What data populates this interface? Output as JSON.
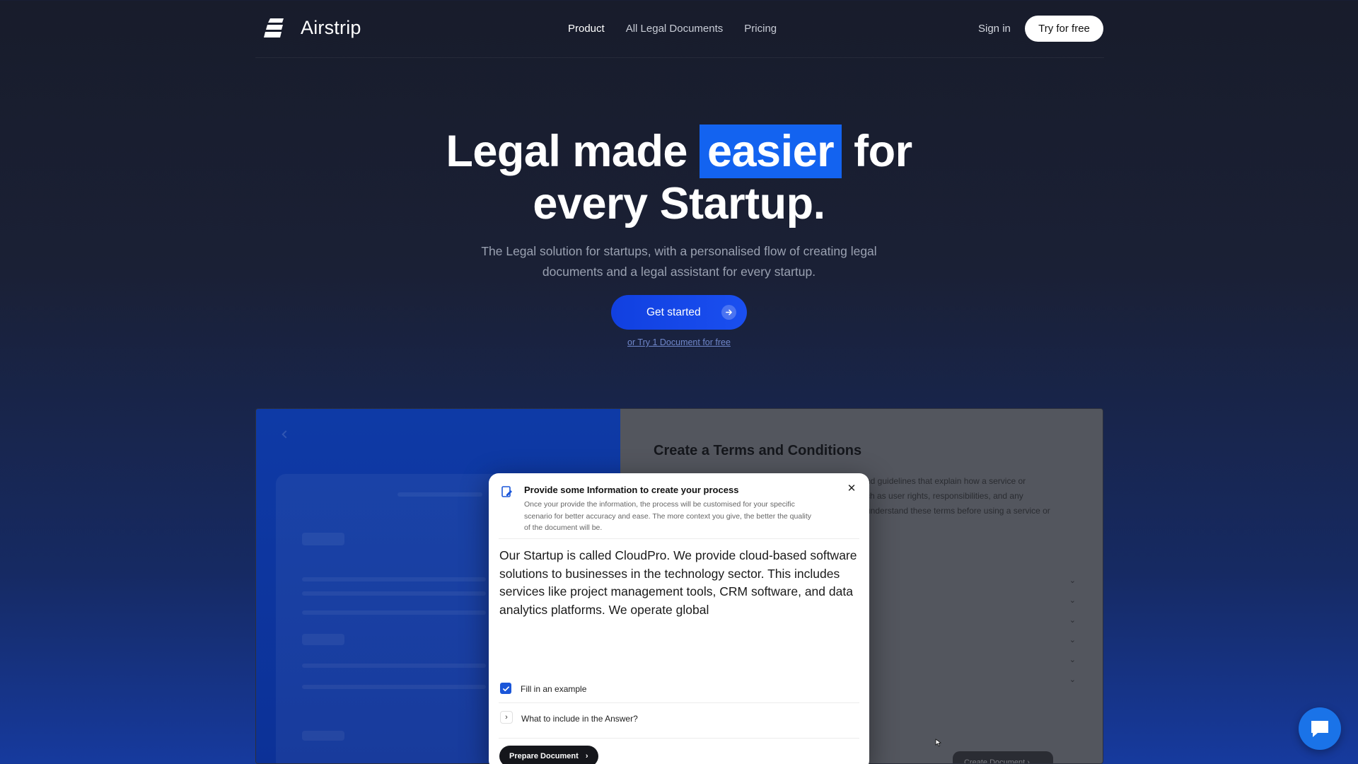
{
  "nav": {
    "brand": "Airstrip",
    "links": [
      "Product",
      "All Legal Documents",
      "Pricing"
    ],
    "sign_in": "Sign in",
    "try_free": "Try for free"
  },
  "hero": {
    "title_part1": "Legal made",
    "title_highlight": "easier",
    "title_part2": "for",
    "title_line2": "every Startup.",
    "subtitle": "The Legal solution for startups, with a personalised flow of creating legal documents and a legal assistant for every startup.",
    "cta_label": "Get started",
    "cta_sub": "or Try 1 Document for free"
  },
  "preview": {
    "title": "Create a Terms and Conditions",
    "desc_lines": [
      "nd guidelines that explain how a service or",
      "ch as user rights, responsibilities, and any",
      "understand these terms before using a service or"
    ],
    "create_button": "Create Document"
  },
  "modal": {
    "title": "Provide some Information to create your process",
    "description": "Once your provide the information, the process will be customised for your specific scenario for better accuracy and ease. The more context you give, the better the quality of the document will be.",
    "text": "Our Startup is called CloudPro. We provide cloud-based software solutions to businesses in the technology sector. This includes services like project management tools, CRM software, and data analytics platforms. We operate global",
    "checkbox_label": "Fill in an example",
    "checkbox_checked": true,
    "accordion_label": "What to include in the Answer?",
    "button_label": "Prepare Document"
  },
  "colors": {
    "accent": "#1363f0",
    "cta": "#1a4ff0",
    "chat": "#1a73e8"
  },
  "icons": {
    "logo": "airstrip-logo-icon",
    "cta": "arrow-right-icon",
    "modal": "document-edit-icon",
    "close": "close-icon",
    "check": "check-icon",
    "chevron": "chevron-right-icon",
    "chat": "chat-bubble-icon"
  }
}
